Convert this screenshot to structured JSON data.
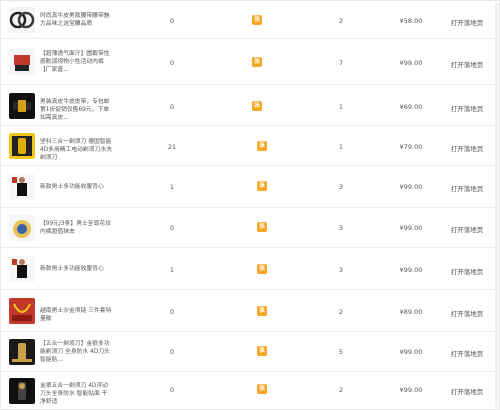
{
  "badge_char": "张",
  "colors": {
    "badge": "#f5a623",
    "divider": "#ececec",
    "text": "#555555"
  },
  "rows": [
    {
      "title": "时尚真牛皮男款腰带腰带魅力品味之选宝腰品质",
      "c1": "0",
      "c3": "2",
      "price": "¥58.00",
      "action": "打开落地页",
      "img": "belt-product-image"
    },
    {
      "title": "【超薄透气面汗】圆截带性感靴孤视物小性活动内裤 【厂家直...",
      "c1": "0",
      "c3": "7",
      "price": "¥99.00",
      "action": "打开落地页",
      "img": "underwear-product-image"
    },
    {
      "title": "男装真皮牛皮皮带，专包邮第1折促销仅售69元，下单如需真皮...",
      "c1": "0",
      "c3": "1",
      "price": "¥69.00",
      "action": "打开落地页",
      "img": "belt-buckle-product-image"
    },
    {
      "title": "坚科三合一剃须刀 德国智能4D多用精工电动剃须刀水洗剃须刀",
      "c1": "21",
      "c3": "1",
      "price": "¥79.00",
      "action": "打开落地页",
      "img": "shaver-product-image"
    },
    {
      "title": "新款男士多功能收腹背心",
      "c1": "1",
      "c3": "3",
      "price": "¥99.00",
      "action": "打开落地页",
      "img": "vest-product-image"
    },
    {
      "title": "【99元/3条】男士至尊花纹内裤超值抹去",
      "c1": "0",
      "c3": "3",
      "price": "¥99.00",
      "action": "打开落地页",
      "img": "briefs-product-image"
    },
    {
      "title": "新款男士多功能收腹背心",
      "c1": "1",
      "c3": "3",
      "price": "¥99.00",
      "action": "打开落地页",
      "img": "vest-product-image"
    },
    {
      "title": "越南男士沙金项链 三件套特量散",
      "c1": "0",
      "c3": "2",
      "price": "¥89.00",
      "action": "打开落地页",
      "img": "necklace-product-image"
    },
    {
      "title": "【五合一剃须刀】金狼多功能剃须刀 全身防水 4D刀头 智能贴...",
      "c1": "0",
      "c3": "5",
      "price": "¥99.00",
      "action": "打开落地页",
      "img": "shaver-gold-product-image"
    },
    {
      "title": "金狼五合一剃须刀 4D浮动刀头全身防水 智能贴面 干净舒适",
      "c1": "0",
      "c3": "2",
      "price": "¥99.00",
      "action": "打开落地页",
      "img": "shaver-black-product-image"
    }
  ]
}
